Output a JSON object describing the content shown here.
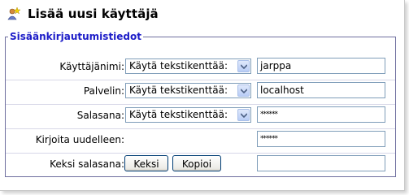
{
  "title": "Lisää uusi käyttäjä",
  "icon_name": "add-user-icon",
  "fieldset": {
    "legend": "Sisäänkirjautumistiedot",
    "legend_color": "#1c1cc8"
  },
  "rows": [
    {
      "label": "Käyttäjänimi:",
      "select_value": "Käytä tekstikenttää:",
      "input_value": "jarppa"
    },
    {
      "label": "Palvelin:",
      "select_value": "Käytä tekstikenttää:",
      "input_value": "localhost"
    },
    {
      "label": "Salasana:",
      "select_value": "Käytä tekstikenttää:",
      "input_value": "******"
    },
    {
      "label": "Kirjoita uudelleen:",
      "input_value": "******"
    },
    {
      "label": "Keksi salasana:",
      "buttons": {
        "generate": "Keksi",
        "copy": "Kopioi"
      },
      "input_value": ""
    }
  ]
}
